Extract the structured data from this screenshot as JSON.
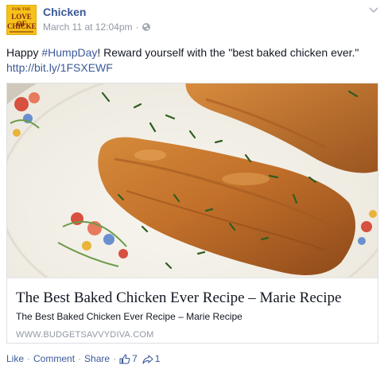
{
  "post": {
    "avatar": {
      "line1": "FOR THE",
      "line2": "LOVE OF",
      "line3": "CHICKEN"
    },
    "page_name": "Chicken",
    "timestamp": "March 11 at 12:04pm",
    "separator": "·",
    "message": {
      "prefix": "Happy ",
      "hashtag": "#HumpDay",
      "suffix": "! Reward yourself with the \"best baked chicken ever.\"",
      "link": "http://bit.ly/1FSXEWF"
    },
    "link_card": {
      "title": "The Best Baked Chicken Ever Recipe – Marie Recipe",
      "description": "The Best Baked Chicken Ever Recipe – Marie Recipe",
      "domain": "WWW.BUDGETSAVVYDIVA.COM"
    },
    "actions": {
      "like": "Like",
      "comment": "Comment",
      "share": "Share",
      "separator": "·",
      "like_count": "7",
      "share_count": "1"
    }
  },
  "colors": {
    "link_blue": "#3b5998",
    "meta_gray": "#9197a3",
    "avatar_yellow": "#f6c21a"
  }
}
